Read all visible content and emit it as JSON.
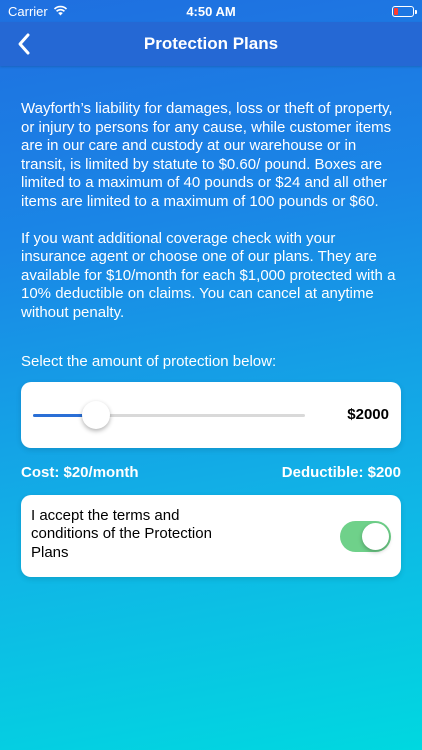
{
  "status_bar": {
    "carrier": "Carrier",
    "time": "4:50 AM",
    "icons": [
      "wifi-icon",
      "battery-icon"
    ]
  },
  "nav": {
    "title": "Protection Plans",
    "back_icon": "chevron-left-icon"
  },
  "body": {
    "paragraph1": "Wayforth’s liability for damages, loss or theft of property, or injury to persons for any cause, while customer items are in our care and custody at our warehouse or in transit, is limited by statute to $0.60/ pound. Boxes are limited to a maximum of 40 pounds or $24 and all other items are limited to a maximum of 100 pounds or $60.",
    "paragraph2": "If you want additional coverage check with your insurance agent or choose one of our plans. They are available for $10/month for each $1,000 protected with a 10% deductible on claims. You can cancel at anytime without penalty.",
    "select_label": "Select the amount of protection below:"
  },
  "slider": {
    "value_label": "$2000",
    "level": 0.23,
    "accent_color": "#2a6fd6"
  },
  "cost": {
    "cost_label": "Cost:  $20/month",
    "deductible_label": "Deductible: $200"
  },
  "terms": {
    "text": "I accept the terms and conditions of the Protection Plans",
    "toggle_on": true,
    "toggle_color": "#6fd18a"
  }
}
